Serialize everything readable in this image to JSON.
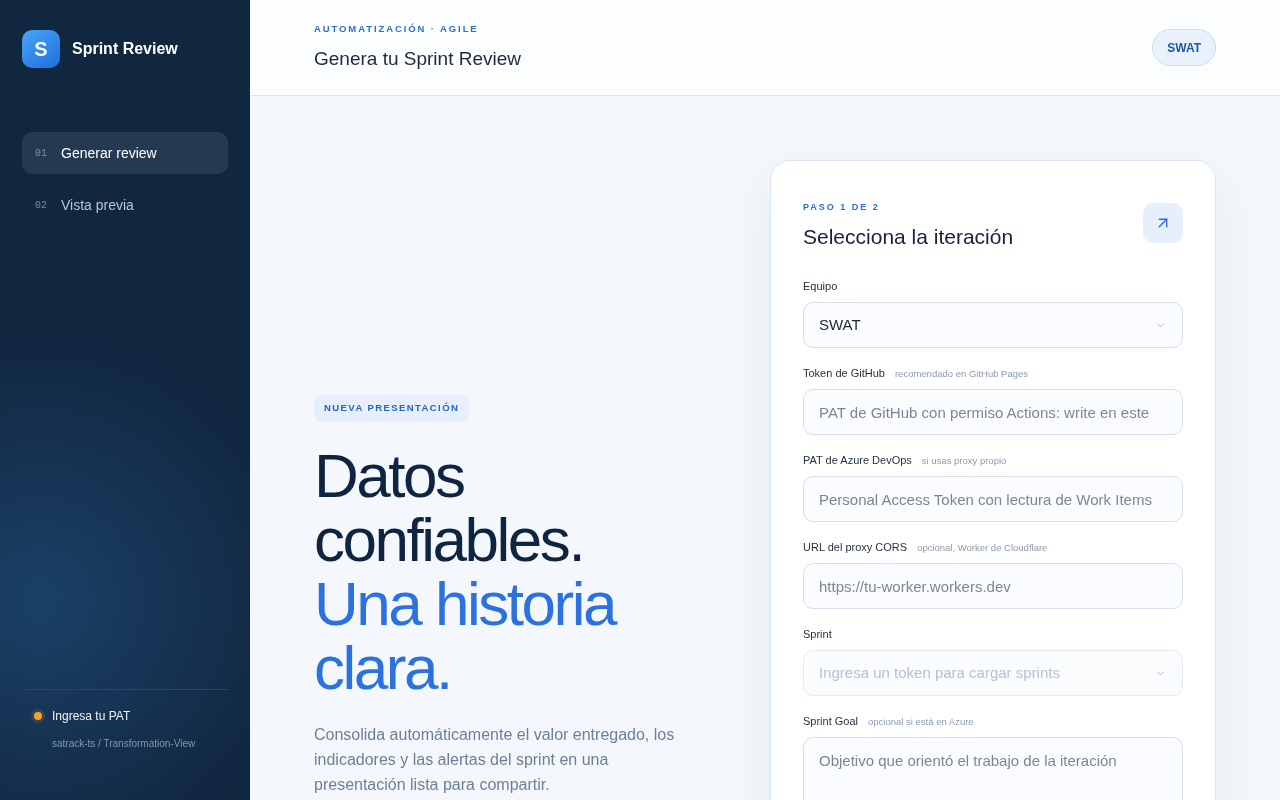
{
  "sidebar": {
    "brand": {
      "mark": "S",
      "name": "Sprint Review"
    },
    "nav": [
      {
        "number": "01",
        "label": "Generar review",
        "selected": true
      },
      {
        "number": "02",
        "label": "Vista previa",
        "selected": false
      }
    ],
    "status": {
      "label": "Ingresa tu PAT",
      "color": "#f5a524",
      "detail": "satrack-ts / Transformation-View"
    }
  },
  "header": {
    "eyebrow": "AUTOMATIZACIÓN · AGILE",
    "title": "Genera tu Sprint Review",
    "team_badge": "SWAT"
  },
  "hero": {
    "tag": "NUEVA PRESENTACIÓN",
    "headline_lead": "Datos confiables.",
    "headline_accent": "Una historia clara.",
    "description": "Consolida automáticamente el valor entregado, los indicadores y las alertas del sprint en una presentación lista para compartir."
  },
  "card": {
    "step": "PASO 1 DE 2",
    "title": "Selecciona la iteración",
    "fields": [
      {
        "kind": "select",
        "label": "Equipo",
        "value": "SWAT",
        "disabled": false
      },
      {
        "kind": "input",
        "label": "Token de GitHub",
        "hint": "recomendado en GitHub Pages",
        "placeholder": "PAT de GitHub con permiso Actions: write en este",
        "disabled": false
      },
      {
        "kind": "input",
        "label": "PAT de Azure DevOps",
        "hint": "si usas proxy propio",
        "placeholder": "Personal Access Token con lectura de Work Items",
        "disabled": false
      },
      {
        "kind": "input",
        "label": "URL del proxy CORS",
        "hint": "opcional, Worker de Cloudflare",
        "placeholder": "https://tu-worker.workers.dev",
        "disabled": false
      },
      {
        "kind": "select",
        "label": "Sprint",
        "placeholder": "Ingresa un token para cargar sprints",
        "disabled": true
      },
      {
        "kind": "textarea",
        "label": "Sprint Goal",
        "hint": "opcional si está en Azure",
        "placeholder": "Objetivo que orientó el trabajo de la iteración",
        "disabled": false
      }
    ]
  }
}
